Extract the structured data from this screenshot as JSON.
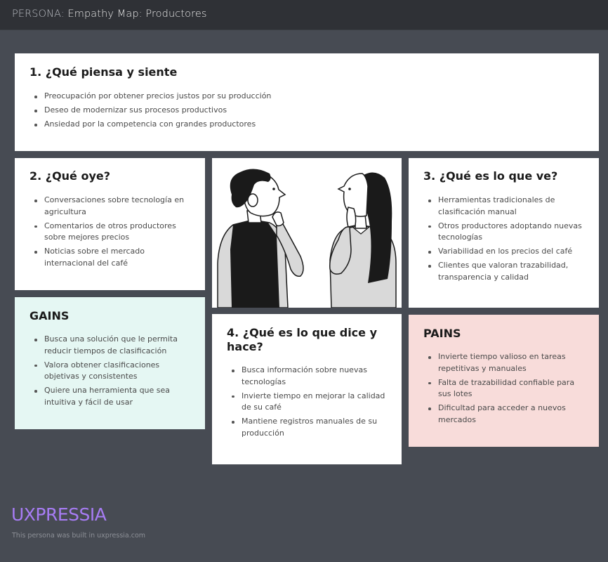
{
  "header": {
    "prefix": "PERSONA:",
    "title": "Empathy Map: Productores"
  },
  "think_feel": {
    "title": "1. ¿Qué piensa y siente",
    "items": [
      "Preocupación por obtener precios justos por su producción",
      "Deseo de modernizar sus procesos productivos",
      "Ansiedad por la competencia con grandes productores"
    ]
  },
  "hear": {
    "title": "2. ¿Qué oye?",
    "items": [
      "Conversaciones sobre tecnología en agricultura",
      "Comentarios de otros productores sobre mejores precios",
      "Noticias sobre el mercado internacional del café"
    ]
  },
  "see": {
    "title": "3. ¿Qué es lo que ve?",
    "items": [
      "Herramientas tradicionales de clasificación manual",
      "Otros productores adoptando nuevas tecnologías",
      "Variabilidad en los precios del café",
      "Clientes que valoran trazabilidad, transparencia y calidad"
    ]
  },
  "gains": {
    "title": "GAINS",
    "items": [
      "Busca una solución que le permita reducir tiempos de clasificación",
      "Valora obtener clasificaciones objetivas y consistentes",
      "Quiere una herramienta que sea intuitiva y fácil de usar"
    ]
  },
  "say_do": {
    "title": "4. ¿Qué es lo que dice y hace?",
    "items": [
      "Busca información sobre nuevas tecnologías",
      "Invierte tiempo en mejorar la calidad de su café",
      "Mantiene registros manuales de su producción"
    ]
  },
  "pains": {
    "title": "PAINS",
    "items": [
      "Invierte tiempo valioso en tareas repetitivas y manuales",
      "Falta de trazabilidad confiable para sus lotes",
      "Dificultad para acceder a nuevos mercados"
    ]
  },
  "illustration": {
    "icon": "two-people-thinking-illustration"
  },
  "footer": {
    "brand": "UXPRESSIA",
    "built_text": "This persona was built in uxpressia.com"
  },
  "colors": {
    "background": "#474b53",
    "topbar": "#2f3136",
    "gains_bg": "#e5f7f3",
    "pains_bg": "#f8dcda",
    "brand": "#a77cf4"
  }
}
